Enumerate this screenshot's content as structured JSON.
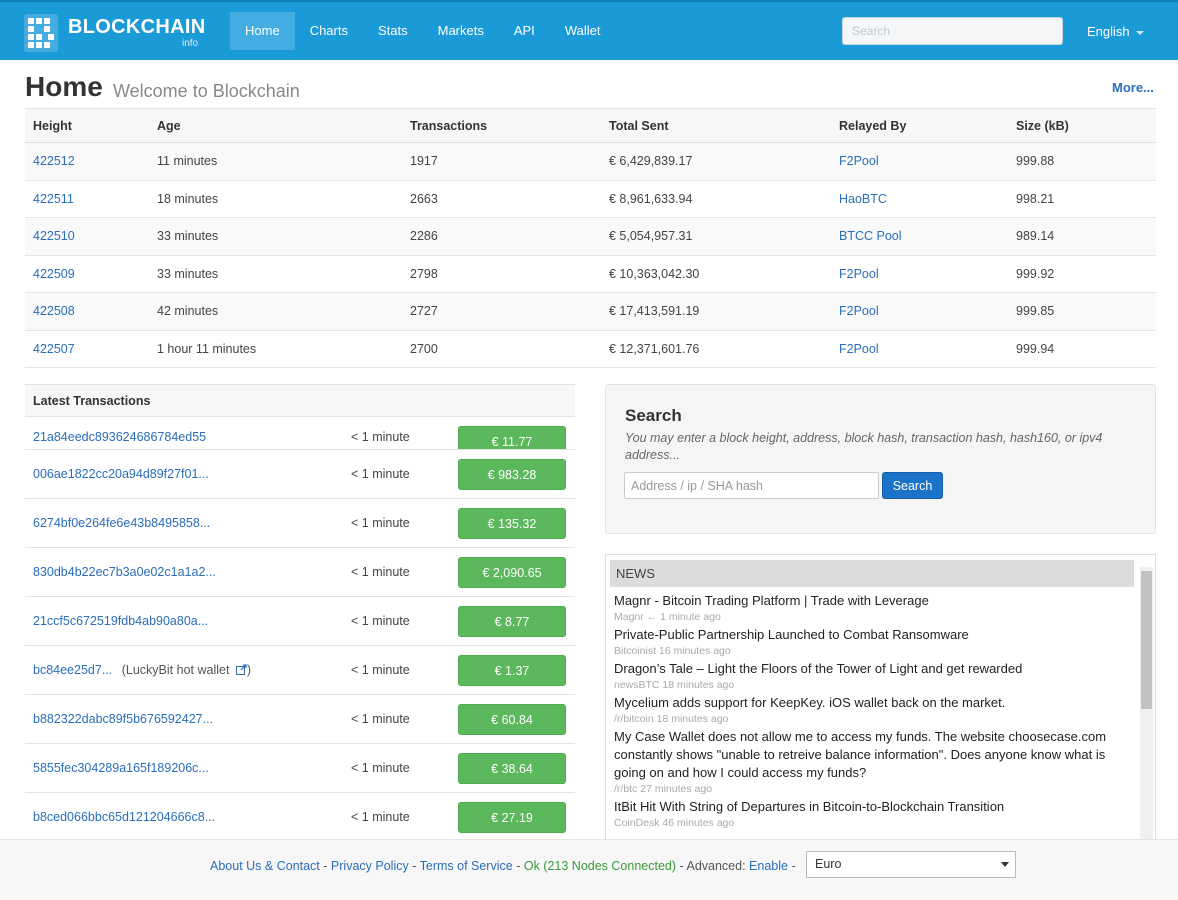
{
  "nav": {
    "logo_text": "BLOCKCHAIN",
    "logo_sub": "info",
    "items": [
      "Home",
      "Charts",
      "Stats",
      "Markets",
      "API",
      "Wallet"
    ],
    "active": "Home",
    "search_placeholder": "Search",
    "language": "English"
  },
  "header": {
    "title": "Home",
    "subtitle": "Welcome to Blockchain",
    "more": "More..."
  },
  "blocks": {
    "columns": [
      "Height",
      "Age",
      "Transactions",
      "Total Sent",
      "Relayed By",
      "Size (kB)"
    ],
    "rows": [
      [
        "422512",
        "11 minutes",
        "1917",
        "€ 6,429,839.17",
        "F2Pool",
        "999.88"
      ],
      [
        "422511",
        "18 minutes",
        "2663",
        "€ 8,961,633.94",
        "HaoBTC",
        "998.21"
      ],
      [
        "422510",
        "33 minutes",
        "2286",
        "€ 5,054,957.31",
        "BTCC Pool",
        "989.14"
      ],
      [
        "422509",
        "33 minutes",
        "2798",
        "€ 10,363,042.30",
        "F2Pool",
        "999.92"
      ],
      [
        "422508",
        "42 minutes",
        "2727",
        "€ 17,413,591.19",
        "F2Pool",
        "999.85"
      ],
      [
        "422507",
        "1 hour 11 minutes",
        "2700",
        "€ 12,371,601.76",
        "F2Pool",
        "999.94"
      ]
    ]
  },
  "transactions": {
    "heading": "Latest Transactions",
    "partial": {
      "hash": "21a84eedc893624686784ed55",
      "age": "< 1 minute",
      "amount": "€ 11.77"
    },
    "rows": [
      {
        "hash": "006ae1822cc20a94d89f27f01...",
        "extra": "",
        "age": "< 1 minute",
        "amount": "€ 983.28"
      },
      {
        "hash": "6274bf0e264fe6e43b8495858...",
        "extra": "",
        "age": "< 1 minute",
        "amount": "€ 135.32"
      },
      {
        "hash": "830db4b22ec7b3a0e02c1a1a2...",
        "extra": "",
        "age": "< 1 minute",
        "amount": "€ 2,090.65"
      },
      {
        "hash": "21ccf5c672519fdb4ab90a80a...",
        "extra": "",
        "age": "< 1 minute",
        "amount": "€ 8.77"
      },
      {
        "hash": "bc84ee25d7...",
        "extra": "(LuckyBit hot wallet",
        "extra_close": ")",
        "age": "< 1 minute",
        "amount": "€ 1.37"
      },
      {
        "hash": "b882322dabc89f5b676592427...",
        "extra": "",
        "age": "< 1 minute",
        "amount": "€ 60.84"
      },
      {
        "hash": "5855fec304289a165f189206c...",
        "extra": "",
        "age": "< 1 minute",
        "amount": "€ 38.64"
      },
      {
        "hash": "b8ced066bbc65d121204666c8...",
        "extra": "",
        "age": "< 1 minute",
        "amount": "€ 27.19"
      }
    ]
  },
  "search": {
    "title": "Search",
    "help": "You may enter a block height, address, block hash, transaction hash, hash160, or ipv4 address...",
    "placeholder": "Address / ip / SHA hash",
    "button": "Search"
  },
  "news": {
    "heading": "NEWS",
    "items": [
      {
        "title": "Magnr - Bitcoin Trading Platform | Trade with Leverage",
        "meta": "Magnr ← 1 minute ago"
      },
      {
        "title": "Private-Public Partnership Launched to Combat Ransomware",
        "meta": "Bitcoinist 16 minutes ago"
      },
      {
        "title": "Dragon’s Tale – Light the Floors of the Tower of Light and get rewarded",
        "meta": "newsBTC 18 minutes ago"
      },
      {
        "title": "Mycelium adds support for KeepKey. iOS wallet back on the market.",
        "meta": "/r/bitcoin 18 minutes ago"
      },
      {
        "title": "My Case Wallet does not allow me to access my funds. The website choosecase.com constantly shows \"unable to retreive balance information\". Does anyone know what is going on and how I could access my funds?",
        "meta": "/r/btc 27 minutes ago"
      },
      {
        "title": "ItBit Hit With String of Departures in Bitcoin-to-Blockchain Transition",
        "meta": "CoinDesk 46 minutes ago"
      }
    ]
  },
  "footer": {
    "about": "About Us & Contact",
    "privacy": "Privacy Policy",
    "terms": "Terms of Service",
    "status": "Ok (213 Nodes Connected)",
    "advanced_label": "Advanced:",
    "advanced_value": "Enable",
    "sep": "-",
    "currency": "Euro"
  }
}
